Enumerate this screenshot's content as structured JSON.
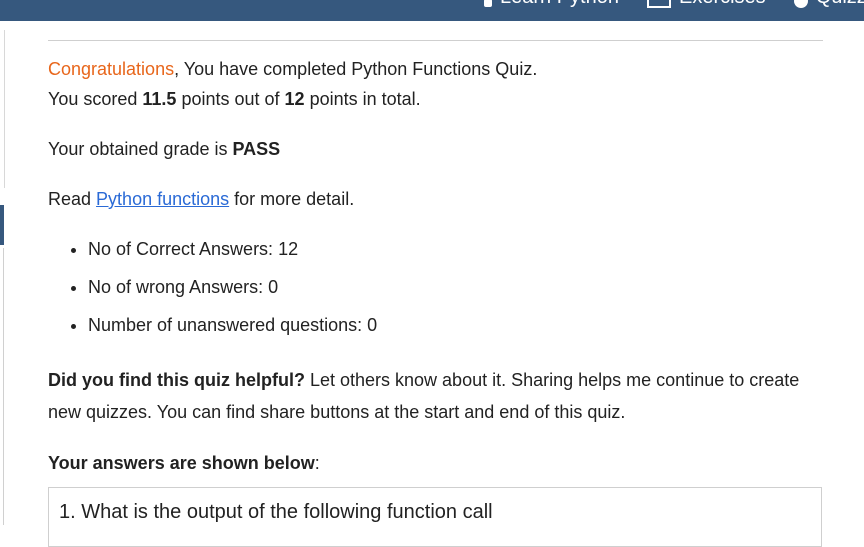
{
  "nav": {
    "items": [
      {
        "label": "Learn Python",
        "icon": "python-icon"
      },
      {
        "label": "Exercises",
        "icon": "laptop-icon"
      },
      {
        "label": "Quizzes",
        "icon": "question-circle-icon"
      }
    ]
  },
  "result": {
    "congrats_word": "Congratulations",
    "congrats_rest": ", You have completed Python Functions Quiz.",
    "score_prefix": "You scored ",
    "score_value": "11.5",
    "score_middle": " points out of ",
    "score_total": "12",
    "score_suffix": " points in total.",
    "grade_prefix": "Your obtained grade is ",
    "grade_value": "PASS",
    "read_prefix": "Read ",
    "read_link": "Python functions",
    "read_suffix": " for more detail."
  },
  "stats": [
    "No of Correct Answers: 12",
    "No of wrong Answers: 0",
    "Number of unanswered questions: 0"
  ],
  "feedback": {
    "bold": "Did you find this quiz helpful?",
    "rest": " Let others know about it. Sharing helps me continue to create new quizzes. You can find share buttons at the start and end of this quiz."
  },
  "answers": {
    "heading_bold": "Your answers are shown below",
    "heading_colon": ":",
    "question_1": "1. What is the output of the following function call"
  },
  "colors": {
    "topbar": "#36587e",
    "accent_orange": "#e8661b",
    "link_blue": "#2a6ad6"
  }
}
